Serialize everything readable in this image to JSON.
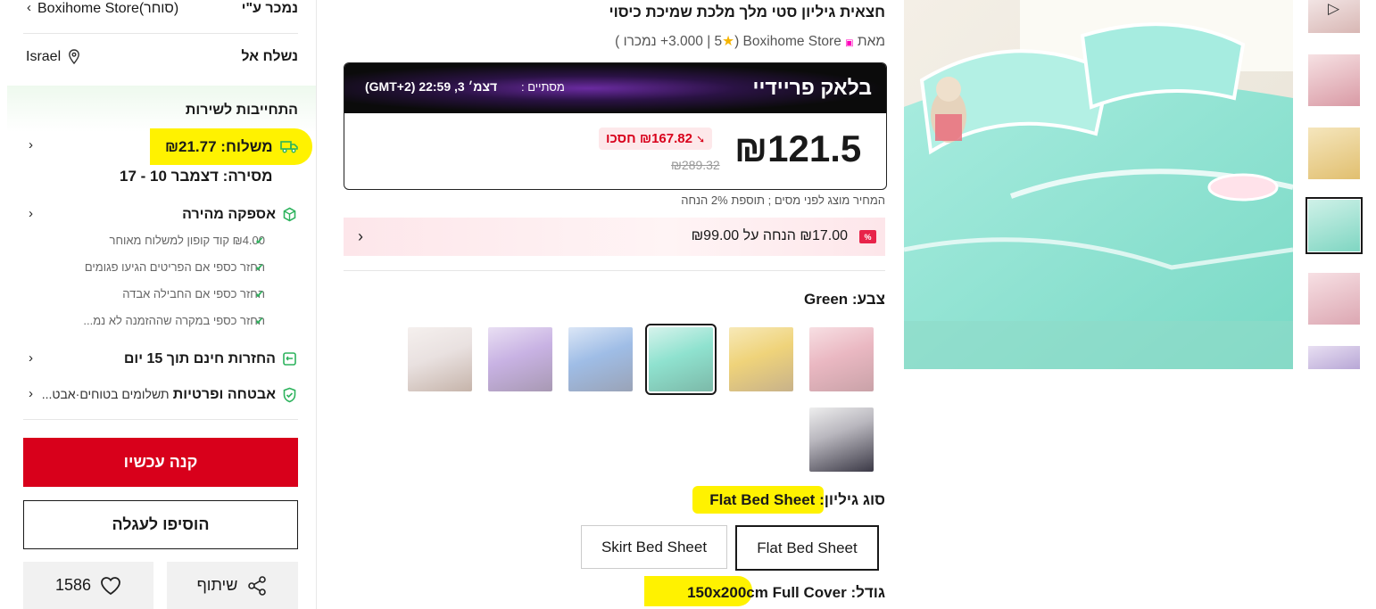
{
  "sidebar": {
    "sold_by_label": "נמכר ע\"י",
    "store_name": "Boxihome Store(סוחר)",
    "ship_to_label": "נשלח אל",
    "ship_to_value": "Israel",
    "service_title": "התחייבות לשירות",
    "shipping": "משלוח: ₪21.77",
    "delivery": "מסירה: דצמבר 10 - 17",
    "fast_delivery": "אספקה מהירה",
    "perks": [
      "₪4.00 קוד קופון למשלוח מאוחר",
      "החזר כספי אם הפריטים הגיעו פגומים",
      "החזר כספי אם החבילה אבדה",
      "החזר כספי במקרה שההזמנה לא נמ..."
    ],
    "free_returns": "החזרות חינם תוך 15 יום",
    "security_title": "אבטחה ופרטיות",
    "security_sub": "תשלומים בטוחים·אבט...",
    "buy_now": "קנה עכשיו",
    "add_to_cart": "הוסיפו לעגלה",
    "share": "שיתוף",
    "wishlist_count": "1586"
  },
  "product": {
    "title": "חצאית גיליון סטי מלך מלכת שמיכת כיסוי",
    "from_label": "מאת",
    "store": "Boxihome Store",
    "rating": "3.000",
    "sold": "5+ נמכרו",
    "deal_title": "בלאק פריידיי",
    "deal_ends_label": "מסתיים :",
    "deal_ends_value": "דצמ׳ 3, 22:59 (GMT+2)",
    "price": "₪121.5",
    "save": "₪167.82 חסכו",
    "original_price": "₪289.32",
    "tax_note": "המחיר מוצג לפני מסים ; תוספת 2% הנחה",
    "coupon": "₪17.00 הנחה על ₪99.00",
    "color_label": "צבע:",
    "color_value": "Green",
    "type_label": "סוג גיליון:",
    "type_value": "Flat Bed Sheet",
    "type_options": [
      "Skirt Bed Sheet",
      "Flat Bed Sheet"
    ],
    "size_label": "גודל:",
    "size_value": "150x200cm Full Cover"
  },
  "colors": {
    "accent_red": "#d8001b",
    "highlight": "#fff200",
    "mint": "#7fe0cf",
    "green_check": "#2db35d"
  }
}
